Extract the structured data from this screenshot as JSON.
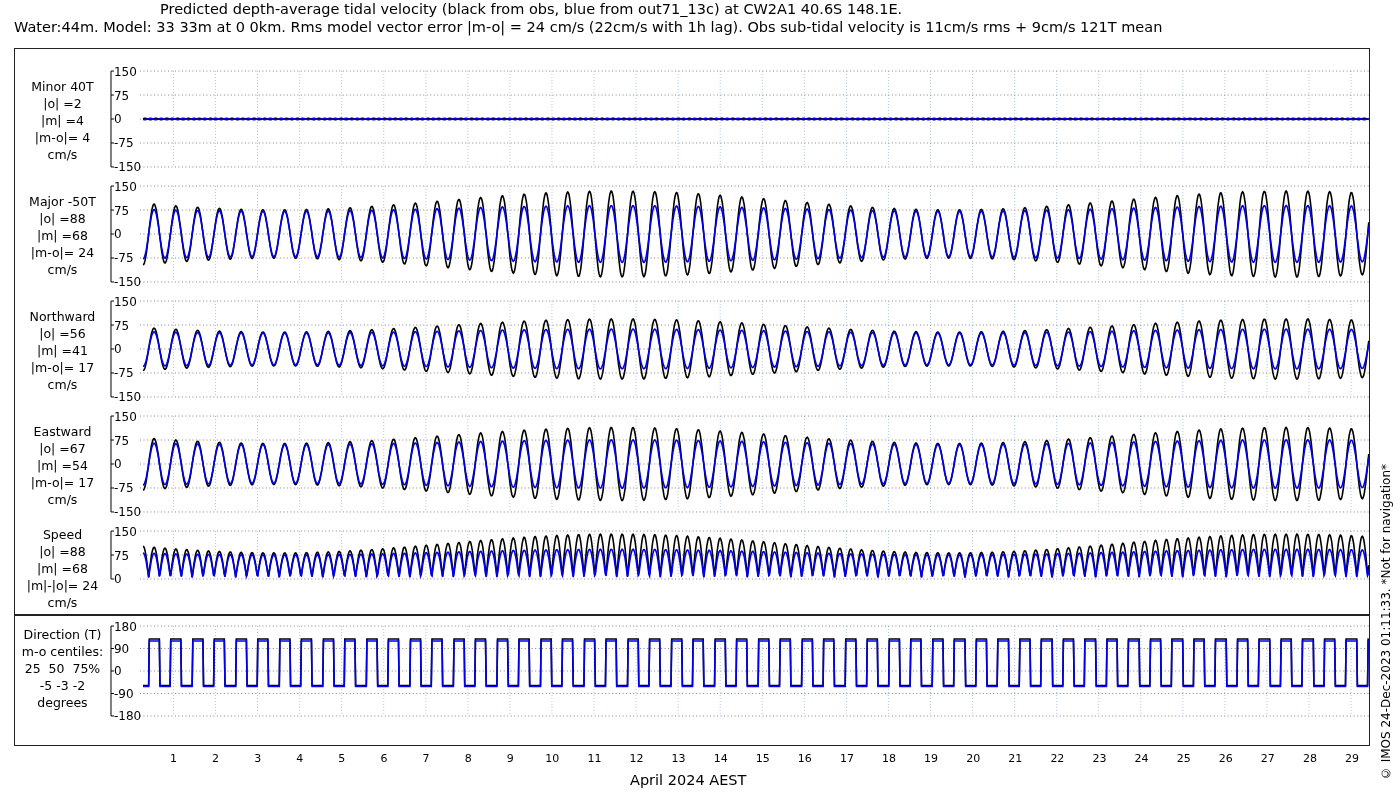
{
  "title": {
    "line_1": "Predicted depth-average tidal velocity (black from obs, blue from out71_13c) at CW2A1 40.6S 148.1E.",
    "line_2": "Water:44m. Model: 33 33m at 0 0km. Rms model vector error |m-o| = 24 cm/s (22cm/s with 1h lag). Obs sub-tidal velocity is 11cm/s rms + 9cm/s 121T mean"
  },
  "panels": [
    {
      "kind": "velocity",
      "label_lines": [
        "Minor 40T",
        "|o| =2",
        "|m| =4",
        "|m-o|= 4",
        "cm/s"
      ],
      "yticks": [
        "150",
        "75",
        "0",
        "-75",
        "-150"
      ]
    },
    {
      "kind": "velocity",
      "label_lines": [
        "Major -50T",
        "|o| =88",
        "|m| =68",
        "|m-o|= 24",
        "cm/s"
      ],
      "yticks": [
        "150",
        "75",
        "0",
        "-75",
        "-150"
      ]
    },
    {
      "kind": "velocity",
      "label_lines": [
        "Northward",
        "|o| =56",
        "|m| =41",
        "|m-o|= 17",
        "cm/s"
      ],
      "yticks": [
        "150",
        "75",
        "0",
        "-75",
        "-150"
      ]
    },
    {
      "kind": "velocity",
      "label_lines": [
        "Eastward",
        "|o| =67",
        "|m| =54",
        "|m-o|= 17",
        "cm/s"
      ],
      "yticks": [
        "150",
        "75",
        "0",
        "-75",
        "-150"
      ]
    },
    {
      "kind": "speed",
      "label_lines": [
        "Speed",
        "|o| =88",
        "|m| =68",
        "|m|-|o|= 24",
        "cm/s"
      ],
      "yticks": [
        "150",
        "75",
        "0"
      ]
    },
    {
      "kind": "direction",
      "label_lines": [
        "Direction (T)",
        "m-o centiles:",
        "25  50  75%",
        "-5 -3 -2",
        "degrees"
      ],
      "yticks": [
        "180",
        "90",
        "0",
        "-90",
        "-180"
      ]
    }
  ],
  "x_axis": {
    "ticks": [
      "1",
      "2",
      "3",
      "4",
      "5",
      "6",
      "7",
      "8",
      "9",
      "10",
      "11",
      "12",
      "13",
      "14",
      "15",
      "16",
      "17",
      "18",
      "19",
      "20",
      "21",
      "22",
      "23",
      "24",
      "25",
      "26",
      "27",
      "28",
      "29"
    ],
    "label": "April 2024 AEST"
  },
  "footer_note": "© IMOS 24-Dec-2023 01:11:33. *Not for navigation*"
}
